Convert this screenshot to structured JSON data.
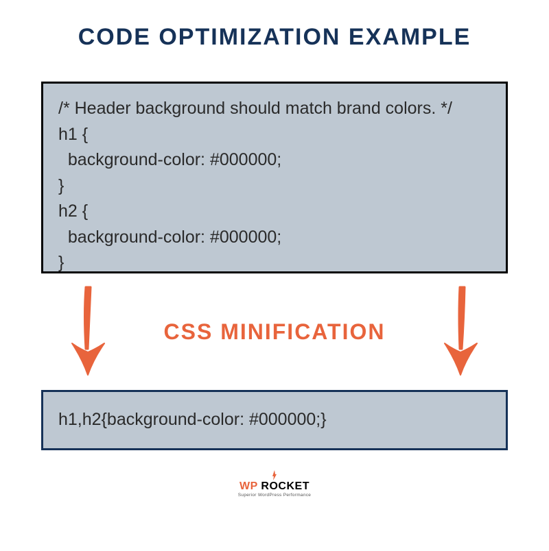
{
  "title": "CODE OPTIMIZATION EXAMPLE",
  "codeBefore": "/* Header background should match brand colors. */\nh1 {\n  background-color: #000000;\n}\nh2 {\n  background-color: #000000;\n}",
  "middleLabel": "CSS MINIFICATION",
  "codeAfter": "h1,h2{background-color: #000000;}",
  "logo": {
    "part1": "WP",
    "part2": " ROCKET",
    "tagline": "Superior WordPress Performance"
  },
  "colors": {
    "navy": "#163258",
    "orange": "#e8643c",
    "boxBg": "#bec8d2"
  }
}
